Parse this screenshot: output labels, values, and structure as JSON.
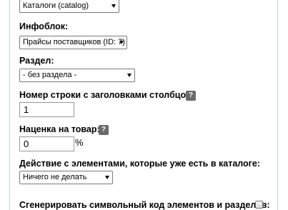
{
  "catalog_select": {
    "value": "Каталоги (catalog)"
  },
  "iblock": {
    "label": "Инфоблок:",
    "select_value": "Прайсы поставщиков (ID: 7)"
  },
  "section": {
    "label": "Раздел:",
    "select_value": "- без раздела -"
  },
  "header_row": {
    "label": "Номер строки с заголовками столбцов:",
    "help": "?",
    "value": "1"
  },
  "markup": {
    "label": "Наценка на товар:",
    "help": "?",
    "value": "0",
    "unit": "%"
  },
  "existing_action": {
    "label": "Действие с элементами, которые уже есть в каталоге:",
    "select_value": "Ничего не делать"
  },
  "generate_code": {
    "label": "Сгенерировать символьный код элементов и разделов:",
    "checked": false
  }
}
